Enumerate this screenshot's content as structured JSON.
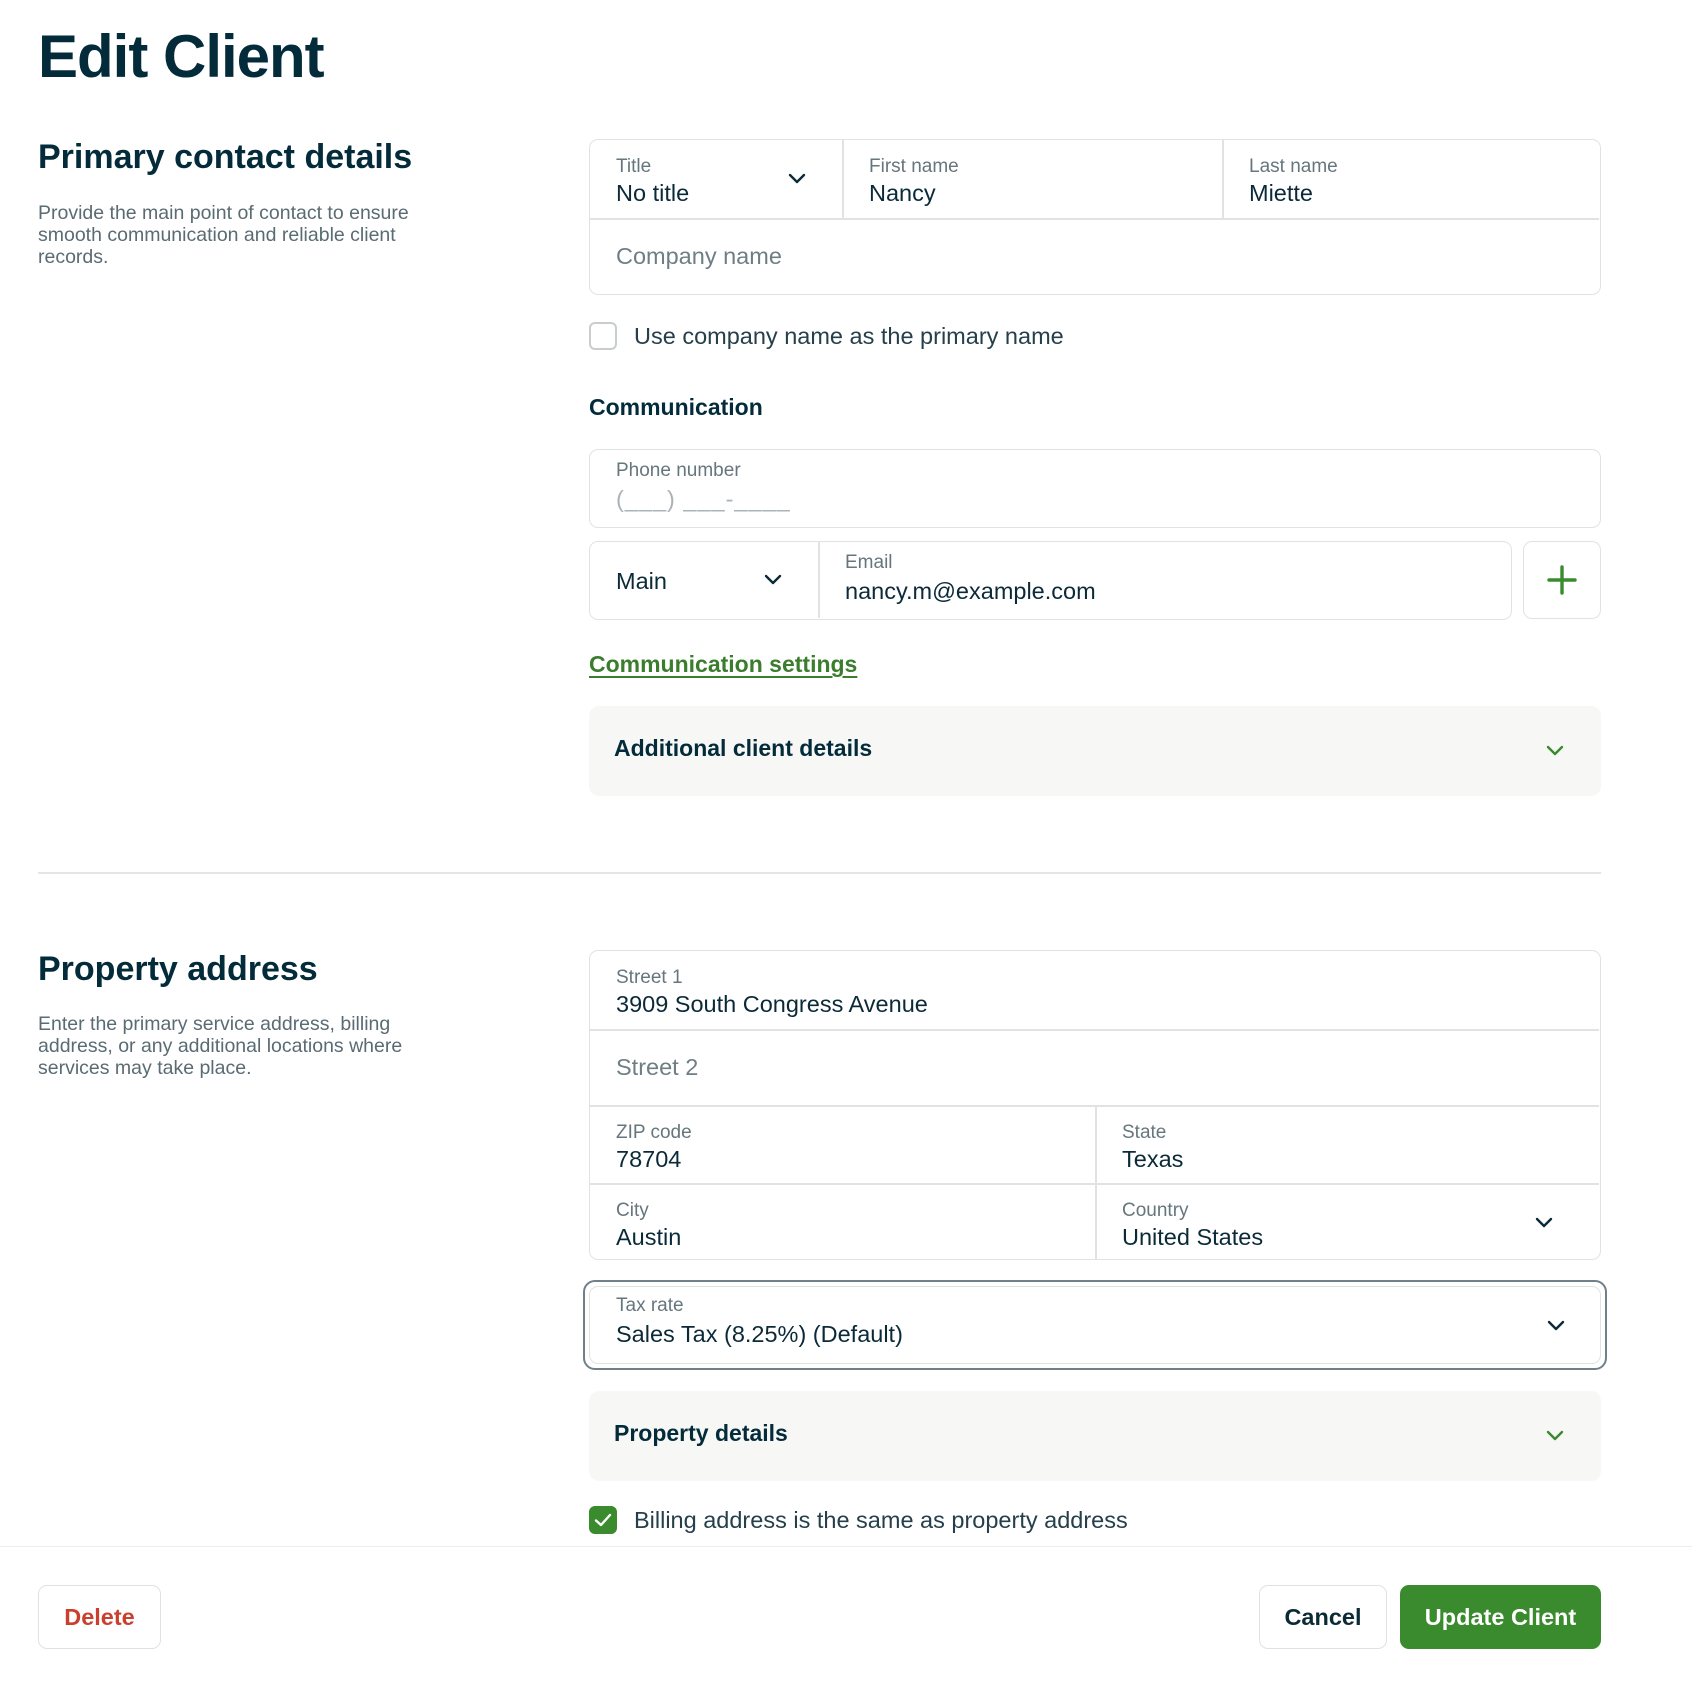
{
  "page_title": "Edit Client",
  "primary_contact": {
    "title": "Primary contact details",
    "description": "Provide the main point of contact to ensure smooth communication and reliable client records.",
    "title_field": {
      "label": "Title",
      "value": "No title"
    },
    "first_name": {
      "label": "First name",
      "value": "Nancy"
    },
    "last_name": {
      "label": "Last name",
      "value": "Miette"
    },
    "company_name": {
      "placeholder": "Company name"
    },
    "use_company_checkbox": {
      "label": "Use company name as the primary name",
      "checked": false
    },
    "communication": {
      "heading": "Communication",
      "phone": {
        "label": "Phone number",
        "placeholder": "(___) ___-____"
      },
      "email_type": "Main",
      "email": {
        "label": "Email",
        "value": "nancy.m@example.com"
      },
      "settings_link": "Communication settings"
    },
    "additional_details": "Additional client details"
  },
  "property_address": {
    "title": "Property address",
    "description": "Enter the primary service address, billing address, or any additional locations where services may take place.",
    "street1": {
      "label": "Street 1",
      "value": "3909 South Congress Avenue"
    },
    "street2": {
      "placeholder": "Street 2"
    },
    "zip": {
      "label": "ZIP code",
      "value": "78704"
    },
    "state": {
      "label": "State",
      "value": "Texas"
    },
    "city": {
      "label": "City",
      "value": "Austin"
    },
    "country": {
      "label": "Country",
      "value": "United States"
    },
    "tax_rate": {
      "label": "Tax rate",
      "value": "Sales Tax (8.25%) (Default)"
    },
    "property_details": "Property details",
    "billing_same_checkbox": {
      "label": "Billing address is the same as property address",
      "checked": true
    }
  },
  "footer": {
    "delete": "Delete",
    "cancel": "Cancel",
    "update": "Update Client"
  },
  "colors": {
    "brand_green": "#3a8b2d",
    "heading": "#032b3a",
    "danger": "#c9402f"
  }
}
